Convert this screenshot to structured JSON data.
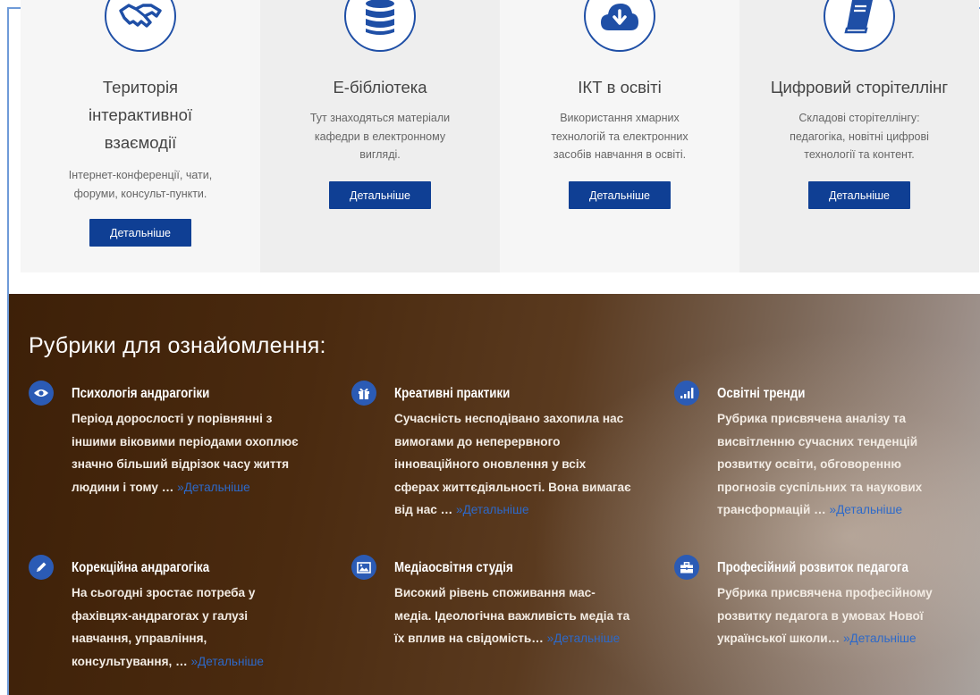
{
  "services": [
    {
      "icon": "handshake-icon",
      "title_lines": [
        "Територія",
        "інтерактивної",
        "взаємодії"
      ],
      "desc_lines": [
        "Інтернет-конференції, чати,",
        "форуми, консульт-пункти."
      ],
      "button": "Детальніше"
    },
    {
      "icon": "database-icon",
      "title_lines": [
        "Е-бібліотека"
      ],
      "desc_lines": [
        "Тут знаходяться матеріали",
        "кафедри в електронному",
        "вигляді."
      ],
      "button": "Детальніше"
    },
    {
      "icon": "cloud-download-icon",
      "title_lines": [
        "ІКТ в освіті"
      ],
      "desc_lines": [
        "Використання хмарних",
        "технологій та електронних",
        "засобів навчання в освіті."
      ],
      "button": "Детальніше"
    },
    {
      "icon": "book-icon",
      "title_lines": [
        "Цифровий сторітеллінг"
      ],
      "desc_lines": [
        "Складові сторітеллінгу:",
        "педагогіка, новітні цифрові",
        "технології та контент."
      ],
      "button": "Детальніше"
    }
  ],
  "rubrics": {
    "heading": "Рубрики для ознайомлення:",
    "items": [
      {
        "icon": "eye-icon",
        "title": "Психологія андрагогіки",
        "text_lines": [
          "Період дорослості у порівнянні з",
          "іншими віковими періодами охоплює",
          "значно більший відрізок часу життя",
          "людини і тому …"
        ],
        "more": "»Детальніше"
      },
      {
        "icon": "gift-icon",
        "title": "Креативні практики",
        "text_lines": [
          "Сучасність несподівано захопила нас",
          "вимогами до неперервного",
          "інноваційного оновлення у всіх",
          "сферах життєдіяльності. Вона вимагає",
          "від нас …"
        ],
        "more": "»Детальніше"
      },
      {
        "icon": "bar-chart-icon",
        "title": "Освітні тренди",
        "text_lines": [
          "Рубрика присвячена аналізу та",
          "висвітленню сучасних тенденцій",
          "розвитку освіти, обговоренню",
          "прогнозів суспільних та наукових",
          "трансформацій …"
        ],
        "more": "»Детальніше"
      },
      {
        "icon": "pencil-icon",
        "title": "Корекційна андрагогіка",
        "text_lines": [
          "На сьогодні зростає потреба у",
          "фахівцях-андрагогах у галузі",
          "навчання, управління,",
          "консультування, …"
        ],
        "more": "»Детальніше"
      },
      {
        "icon": "picture-icon",
        "title": "Медіаосвітня студія",
        "text_lines": [
          "Високий рівень споживання мас-",
          "медіа. Ідеологічна важливість медіа та",
          "їх вплив на свідомість…"
        ],
        "more": "»Детальніше"
      },
      {
        "icon": "briefcase-icon",
        "title": "Професійний розвиток педагога",
        "text_lines": [
          "Рубрика присвячена професійному",
          "розвитку педагога в умовах Нової",
          "української школи…"
        ],
        "more": "»Детальніше"
      }
    ]
  },
  "colors": {
    "accent": "#0f3f94",
    "icon_blue": "#2b5bb5",
    "link_blue": "#2d69c9"
  }
}
